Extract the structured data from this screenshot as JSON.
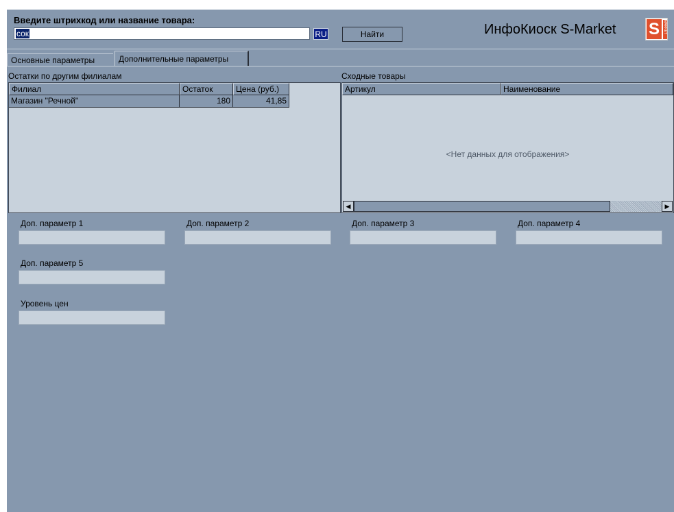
{
  "search": {
    "label": "Введите штрихкод или название товара:",
    "value": "сок",
    "language": "RU",
    "find_label": "Найти"
  },
  "brand": {
    "name": "ИнфоКиоск S-Market",
    "logo_letter": "S",
    "logo_sub": "MARKET",
    "logo_color": "#e0502c"
  },
  "tabs": [
    {
      "label": "Основные параметры",
      "active": false
    },
    {
      "label": "Дополнительные параметры",
      "active": true
    }
  ],
  "branches": {
    "title": "Остатки по другим филиалам",
    "columns": [
      "Филиал",
      "Остаток",
      "Цена (руб.)"
    ],
    "rows": [
      {
        "branch": "Магазин \"Речной\"",
        "stock": "180",
        "price": "41,85"
      }
    ]
  },
  "similar": {
    "title": "Сходные товары",
    "columns": [
      "Артикул",
      "Наименование"
    ],
    "empty_text": "<Нет данных для отображения>"
  },
  "params": [
    {
      "label": "Доп. параметр 1",
      "value": ""
    },
    {
      "label": "Доп. параметр 2",
      "value": ""
    },
    {
      "label": "Доп. параметр 3",
      "value": ""
    },
    {
      "label": "Доп. параметр 4",
      "value": ""
    },
    {
      "label": "Доп. параметр 5",
      "value": ""
    },
    {
      "label": "Уровень цен",
      "value": ""
    }
  ],
  "colors": {
    "window_bg": "#8698ae",
    "panel_bg": "#c8d2dc",
    "selection": "#0a246a"
  }
}
